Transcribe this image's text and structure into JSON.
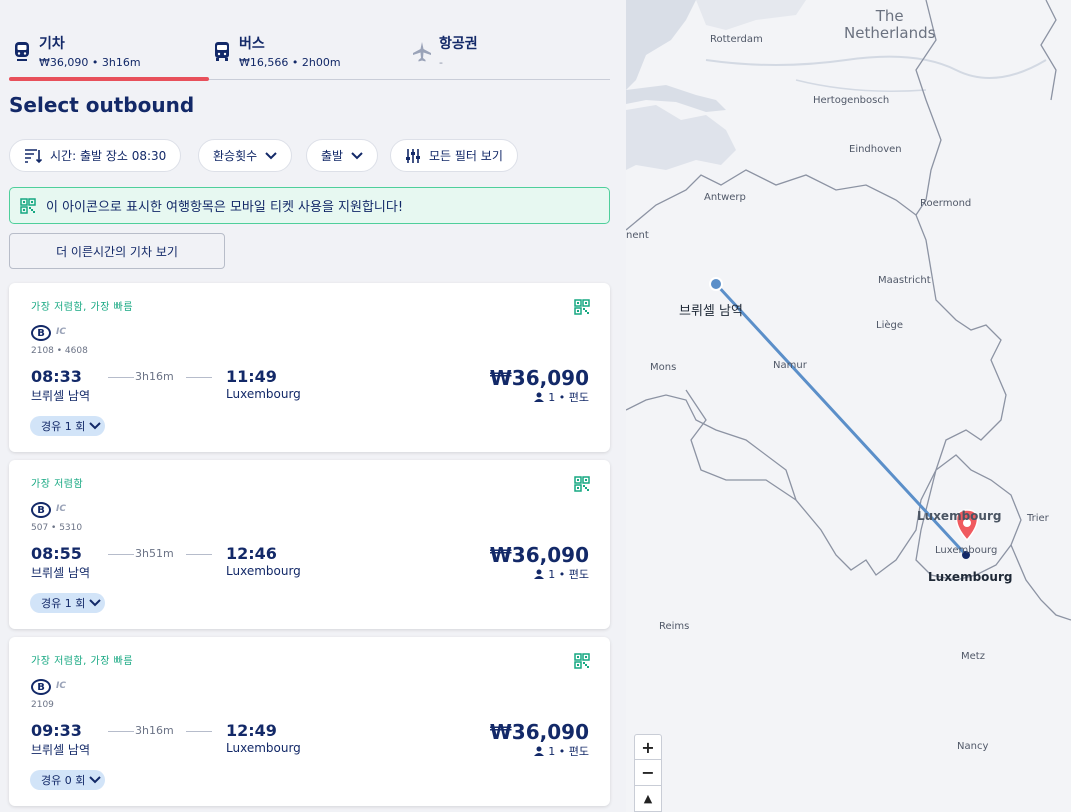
{
  "tabs": [
    {
      "label": "기차",
      "sub": "₩36,090 • 3h16m",
      "icon": "train-icon",
      "active": true
    },
    {
      "label": "버스",
      "sub": "₩16,566 • 2h00m",
      "icon": "bus-icon",
      "active": false
    },
    {
      "label": "항공권",
      "sub": "-",
      "icon": "plane-icon",
      "active": false
    }
  ],
  "heading": "Select outbound",
  "filters": {
    "time": "시간: 출발 장소 08:30",
    "transfers": "환승횟수",
    "departure": "출발",
    "all_filters": "모든 필터 보기"
  },
  "notice": "이 아이콘으로 표시한 여행항목은 모바일 티켓 사용을 지원합니다!",
  "earlier_button": "더 이른시간의 기차 보기",
  "results": [
    {
      "badge": "가장 저렴함, 가장 빠름",
      "carrier_logo": "B",
      "carrier_type": "IC",
      "train_no": "2108 • 4608",
      "dep_time": "08:33",
      "duration": "3h16m",
      "arr_time": "11:49",
      "dep_station": "브뤼셀 남역",
      "arr_station": "Luxembourg",
      "price": "₩36,090",
      "pax": "1 • 편도",
      "stops": "경유 1 회"
    },
    {
      "badge": "가장 저렴함",
      "carrier_logo": "B",
      "carrier_type": "IC",
      "train_no": "507 • 5310",
      "dep_time": "08:55",
      "duration": "3h51m",
      "arr_time": "12:46",
      "dep_station": "브뤼셀 남역",
      "arr_station": "Luxembourg",
      "price": "₩36,090",
      "pax": "1 • 편도",
      "stops": "경유 1 회"
    },
    {
      "badge": "가장 저렴함, 가장 빠름",
      "carrier_logo": "B",
      "carrier_type": "IC",
      "train_no": "2109",
      "dep_time": "09:33",
      "duration": "3h16m",
      "arr_time": "12:49",
      "dep_station": "브뤼셀 남역",
      "arr_station": "Luxembourg",
      "price": "₩36,090",
      "pax": "1 • 편도",
      "stops": "경유 0 회"
    }
  ],
  "map": {
    "countries": {
      "netherlands": "The\nNetherlands"
    },
    "cities": {
      "rotterdam": "Rotterdam",
      "hertogenbosch": "Hertogenbosch",
      "eindhoven": "Eindhoven",
      "antwerp": "Antwerp",
      "roermond": "Roermond",
      "gent": "nent",
      "maastricht": "Maastricht",
      "liege": "Liège",
      "mons": "Mons",
      "namur": "Namur",
      "trier": "Trier",
      "reims": "Reims",
      "metz": "Metz",
      "nancy": "Nancy",
      "luxembourg_small": "Luxembourg",
      "luxembourg_country": "Luxembourg",
      "brussels_origin": "브뤼셀 남역",
      "luxembourg_dest": "Luxembourg"
    },
    "zoom_in": "+",
    "zoom_out": "−",
    "compass": "▲"
  },
  "colors": {
    "accent": "#e8505b",
    "navy": "#132968",
    "green": "#17a882",
    "route": "#5b8fc9"
  }
}
